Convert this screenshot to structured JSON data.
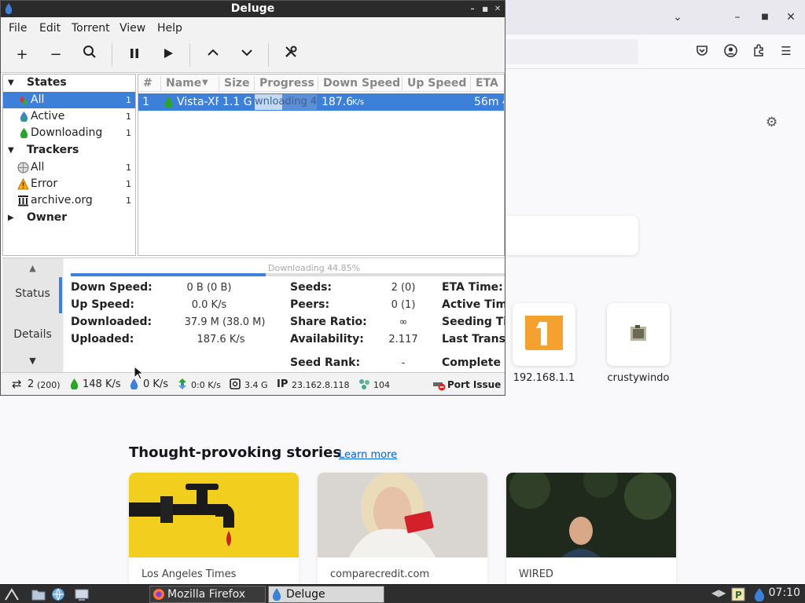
{
  "firefox": {
    "window_title": "Mozilla Firefox",
    "tiles": [
      {
        "label": "192.168.1.1"
      },
      {
        "label": "crustywindo"
      }
    ],
    "stories": {
      "title": "Thought-provoking stories",
      "learn_more": "Learn more",
      "cards": [
        {
          "source": "Los Angeles Times"
        },
        {
          "source": "comparecredit.com"
        },
        {
          "source": "WIRED"
        }
      ]
    }
  },
  "deluge": {
    "title": "Deluge",
    "menu": [
      "File",
      "Edit",
      "Torrent",
      "View",
      "Help"
    ],
    "toolbar_icons": [
      "add-icon",
      "remove-icon",
      "search-icon",
      "pause-icon",
      "play-icon",
      "move-up-icon",
      "move-down-icon",
      "preferences-icon"
    ],
    "sidebar": {
      "states_header": "States",
      "states": [
        {
          "label": "All",
          "count": "1"
        },
        {
          "label": "Active",
          "count": "1"
        },
        {
          "label": "Downloading",
          "count": "1"
        }
      ],
      "trackers_header": "Trackers",
      "trackers": [
        {
          "label": "All",
          "count": "1"
        },
        {
          "label": "Error",
          "count": "1"
        },
        {
          "label": "archive.org",
          "count": "1"
        }
      ],
      "owner_header": "Owner"
    },
    "list": {
      "columns": [
        "#",
        "Name",
        "Size",
        "Progress",
        "Down Speed",
        "Up Speed",
        "ETA"
      ],
      "rows": [
        {
          "num": "1",
          "name": "Vista-XF",
          "size": "1.1 G",
          "progress_text": "wnloading 4",
          "progress": 0.4485,
          "down": "187.6",
          "down_unit": "K/s",
          "eta": "56m 4"
        }
      ]
    },
    "details": {
      "tabs": [
        "Status",
        "Details"
      ],
      "progress_text": "Downloading 44.85%",
      "progress": 0.4485,
      "col1": [
        {
          "k": "Down Speed:",
          "v": "0 B (0 B)"
        },
        {
          "k": "Up Speed:",
          "v": "0.0 K/s"
        },
        {
          "k": "Downloaded:",
          "v": "37.9 M (38.0 M)"
        },
        {
          "k": "Uploaded:",
          "v": "187.6 K/s"
        }
      ],
      "col2": [
        {
          "k": "Seeds:",
          "v": "2 (0)"
        },
        {
          "k": "Peers:",
          "v": "0 (1)"
        },
        {
          "k": "Share Ratio:",
          "v": "∞"
        },
        {
          "k": "Availability:",
          "v": "2.117"
        },
        {
          "k": "Seed Rank:",
          "v": "-"
        }
      ],
      "col3": [
        "ETA Time:",
        "Active Tim",
        "Seeding Ti",
        "Last Transf",
        "Complete S"
      ]
    },
    "statusbar": {
      "connections": "2",
      "connections_max": "(200)",
      "down": "148 K/s",
      "up": "0 K/s",
      "proto": "0:0 K/s",
      "disk": "3.4 G",
      "ip_label": "IP",
      "ip": "23.162.8.118",
      "dht": "104",
      "port_issue": "Port Issue"
    }
  },
  "taskbar": {
    "tasks": [
      {
        "label": "Mozilla Firefox"
      },
      {
        "label": "Deluge"
      }
    ],
    "clock": "07:10"
  }
}
